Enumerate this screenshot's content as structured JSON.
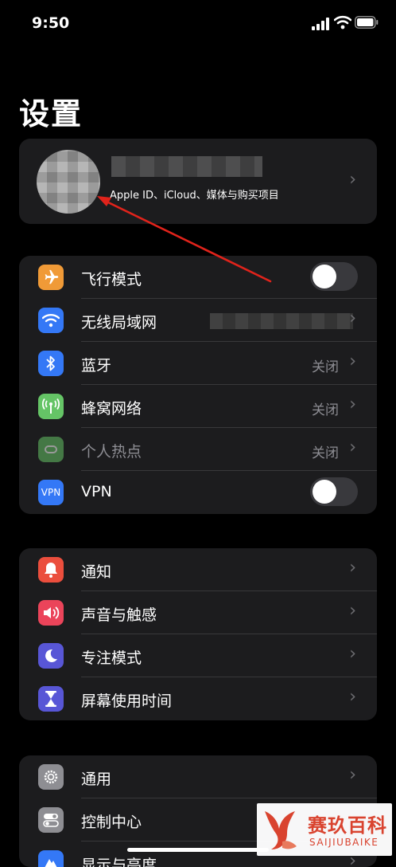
{
  "status_bar": {
    "time": "9:50"
  },
  "page_title": "设置",
  "profile": {
    "subtitle": "Apple ID、iCloud、媒体与购买项目"
  },
  "group_network": {
    "items": [
      {
        "label": "飞行模式",
        "icon": "airplane-icon",
        "color": "#f09a37",
        "control": "toggle",
        "on": false
      },
      {
        "label": "无线局域网",
        "icon": "wifi-icon",
        "color": "#3478f6",
        "control": "chevron"
      },
      {
        "label": "蓝牙",
        "icon": "bluetooth-icon",
        "color": "#3478f6",
        "value": "关闭",
        "control": "chevron"
      },
      {
        "label": "蜂窝网络",
        "icon": "cellular-icon",
        "color": "#65c466",
        "value": "关闭",
        "control": "chevron"
      },
      {
        "label": "个人热点",
        "icon": "hotspot-icon",
        "color": "#65c466",
        "value": "关闭",
        "control": "chevron",
        "disabled": true
      },
      {
        "label": "VPN",
        "icon": "vpn-icon",
        "color": "#3478f6",
        "icon_text": "VPN",
        "control": "toggle",
        "on": false
      }
    ]
  },
  "group_notify": {
    "items": [
      {
        "label": "通知",
        "icon": "bell-icon",
        "color": "#eb4e3d"
      },
      {
        "label": "声音与触感",
        "icon": "speaker-icon",
        "color": "#eb445a"
      },
      {
        "label": "专注模式",
        "icon": "moon-icon",
        "color": "#5856d6"
      },
      {
        "label": "屏幕使用时间",
        "icon": "hourglass-icon",
        "color": "#5856d6"
      }
    ]
  },
  "group_general": {
    "items": [
      {
        "label": "通用",
        "icon": "gear-icon",
        "color": "#8e8e93"
      },
      {
        "label": "控制中心",
        "icon": "switches-icon",
        "color": "#8e8e93"
      },
      {
        "label": "显示与亮度",
        "icon": "brightness-icon",
        "color": "#3478f6"
      }
    ]
  },
  "watermark": {
    "title": "赛玖百科",
    "subtitle": "SAIJIUBAIKE"
  }
}
